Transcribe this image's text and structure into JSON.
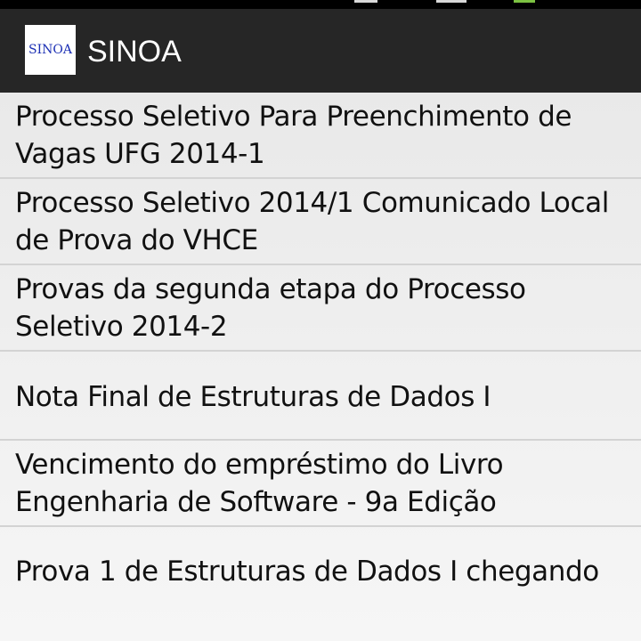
{
  "app": {
    "title": "SINOA",
    "logo_text": "SINOA"
  },
  "notifications": [
    "Processo Seletivo Para Preenchimento de Vagas UFG 2014-1",
    "Processo Seletivo 2014/1 Comunicado Local de Prova do VHCE",
    "Provas da segunda etapa do Processo Seletivo 2014-2",
    "Nota Final de Estruturas de Dados I",
    "Vencimento do empréstimo do Livro Engenharia de Software - 9a Edição",
    "Prova 1 de Estruturas de Dados I chegando"
  ],
  "colors": {
    "action_bar": "#262626",
    "logo_text": "#1b2fb4",
    "list_background": "#f2f2f2",
    "divider": "#d3d3d3"
  }
}
